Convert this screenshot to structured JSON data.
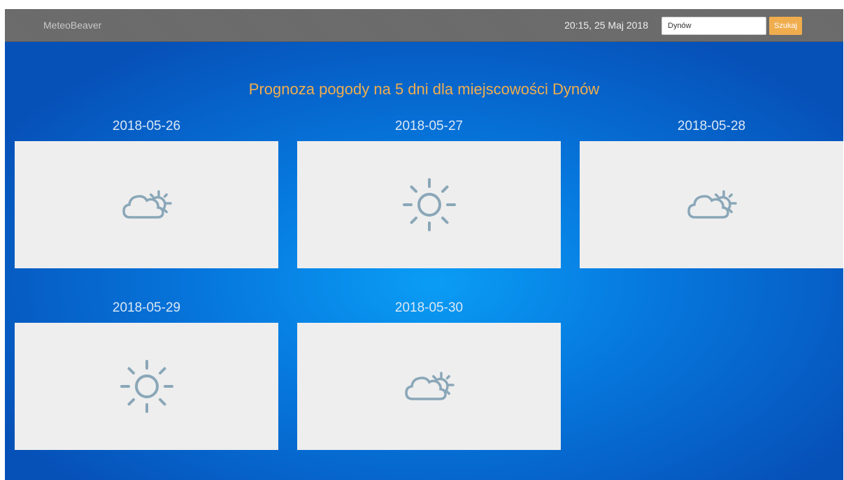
{
  "navbar": {
    "brand": "MeteoBeaver",
    "datetime": "20:15, 25 Maj 2018",
    "search_value": "Dynów",
    "search_button": "Szukaj"
  },
  "title": "Prognoza pogody na 5 dni dla miejscowości Dynów",
  "forecast": [
    {
      "date": "2018-05-26",
      "icon": "partly-cloudy-icon"
    },
    {
      "date": "2018-05-27",
      "icon": "sun-icon"
    },
    {
      "date": "2018-05-28",
      "icon": "partly-cloudy-icon"
    },
    {
      "date": "2018-05-29",
      "icon": "sun-icon"
    },
    {
      "date": "2018-05-30",
      "icon": "partly-cloudy-icon"
    }
  ],
  "colors": {
    "accent": "#f0ad4e",
    "icon": "#8aa7b8",
    "card": "#eeeeee",
    "navbar": "#6b6b6b",
    "background_center": "#0a9df5",
    "background_edge": "#0651b8"
  }
}
